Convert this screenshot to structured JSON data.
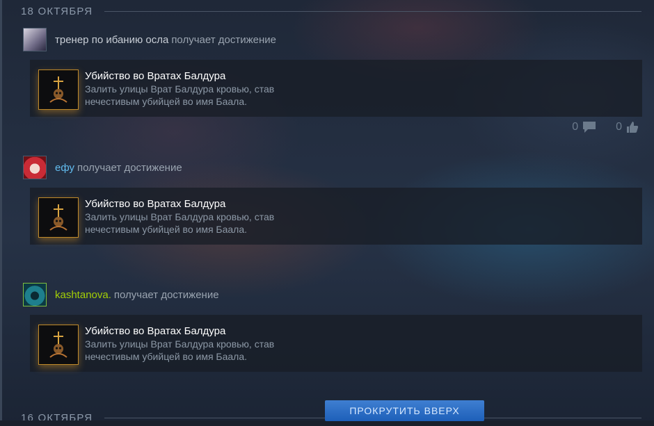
{
  "date_groups": [
    {
      "label": "18 ОКТЯБРЯ"
    },
    {
      "label": "16 ОКТЯБРЯ"
    }
  ],
  "posts": [
    {
      "user": "тренер по ибанию осла",
      "verb": "получает достижение",
      "achievement": {
        "title": "Убийство во Вратах Балдура",
        "description": "Залить улицы Врат Балдура кровью, став нечестивым убийцей во имя Баала."
      },
      "comments": "0",
      "likes": "0"
    },
    {
      "user": "ефу",
      "verb": "получает достижение",
      "achievement": {
        "title": "Убийство во Вратах Балдура",
        "description": "Залить улицы Врат Балдура кровью, став нечестивым убийцей во имя Баала."
      }
    },
    {
      "user": "kashtanova.",
      "verb": "получает достижение",
      "achievement": {
        "title": "Убийство во Вратах Балдура",
        "description": "Залить улицы Врат Балдура кровью, став нечестивым убийцей во имя Баала."
      }
    }
  ],
  "scroll_top_label": "ПРОКРУТИТЬ ВВЕРХ",
  "icons": {
    "comment": "comment-icon",
    "like": "thumbs-up-icon",
    "achievement": "dagger-skull-icon"
  },
  "colors": {
    "friend_name": "#62bcef",
    "ingame_name": "#a3cf06",
    "button": "#1d5fb9"
  }
}
